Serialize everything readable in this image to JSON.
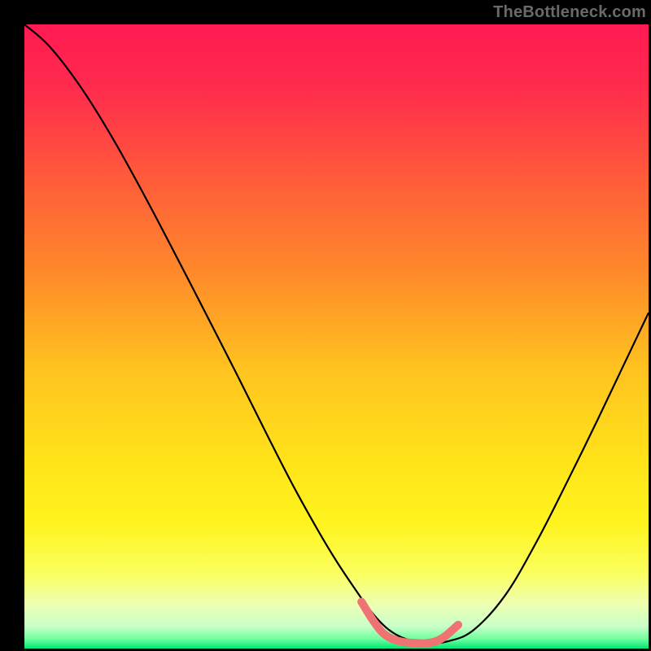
{
  "watermark": "TheBottleneck.com",
  "chart_data": {
    "type": "line",
    "title": "",
    "xlabel": "",
    "ylabel": "",
    "xlim": [
      0,
      1
    ],
    "ylim": [
      0,
      1
    ],
    "gradient_stops": [
      {
        "offset": 0.0,
        "color": "#ff1a52"
      },
      {
        "offset": 0.1,
        "color": "#ff2b4d"
      },
      {
        "offset": 0.25,
        "color": "#ff5c3a"
      },
      {
        "offset": 0.4,
        "color": "#ff8a2a"
      },
      {
        "offset": 0.55,
        "color": "#ffc21f"
      },
      {
        "offset": 0.7,
        "color": "#ffe31a"
      },
      {
        "offset": 0.8,
        "color": "#fff41e"
      },
      {
        "offset": 0.88,
        "color": "#fbff60"
      },
      {
        "offset": 0.93,
        "color": "#edffb4"
      },
      {
        "offset": 0.965,
        "color": "#c8ffc8"
      },
      {
        "offset": 0.985,
        "color": "#6cff9d"
      },
      {
        "offset": 1.0,
        "color": "#00e676"
      }
    ],
    "series": [
      {
        "name": "bottleneck-curve",
        "stroke": "#000000",
        "stroke_width": 2.2,
        "x": [
          0.0,
          0.04,
          0.09,
          0.14,
          0.19,
          0.24,
          0.29,
          0.34,
          0.39,
          0.43,
          0.47,
          0.5,
          0.53,
          0.555,
          0.578,
          0.6,
          0.623,
          0.648,
          0.68,
          0.72,
          0.77,
          0.82,
          0.87,
          0.92,
          0.97,
          1.0
        ],
        "y": [
          1.0,
          0.965,
          0.9,
          0.82,
          0.73,
          0.635,
          0.538,
          0.44,
          0.34,
          0.262,
          0.19,
          0.14,
          0.095,
          0.06,
          0.035,
          0.02,
          0.012,
          0.009,
          0.012,
          0.03,
          0.085,
          0.17,
          0.268,
          0.37,
          0.475,
          0.538
        ]
      },
      {
        "name": "trough-marker",
        "stroke": "#ef7373",
        "stroke_width": 10,
        "linecap": "round",
        "x": [
          0.54,
          0.56,
          0.578,
          0.6,
          0.623,
          0.648,
          0.67,
          0.695
        ],
        "y": [
          0.075,
          0.043,
          0.022,
          0.012,
          0.009,
          0.009,
          0.017,
          0.038
        ]
      }
    ]
  }
}
